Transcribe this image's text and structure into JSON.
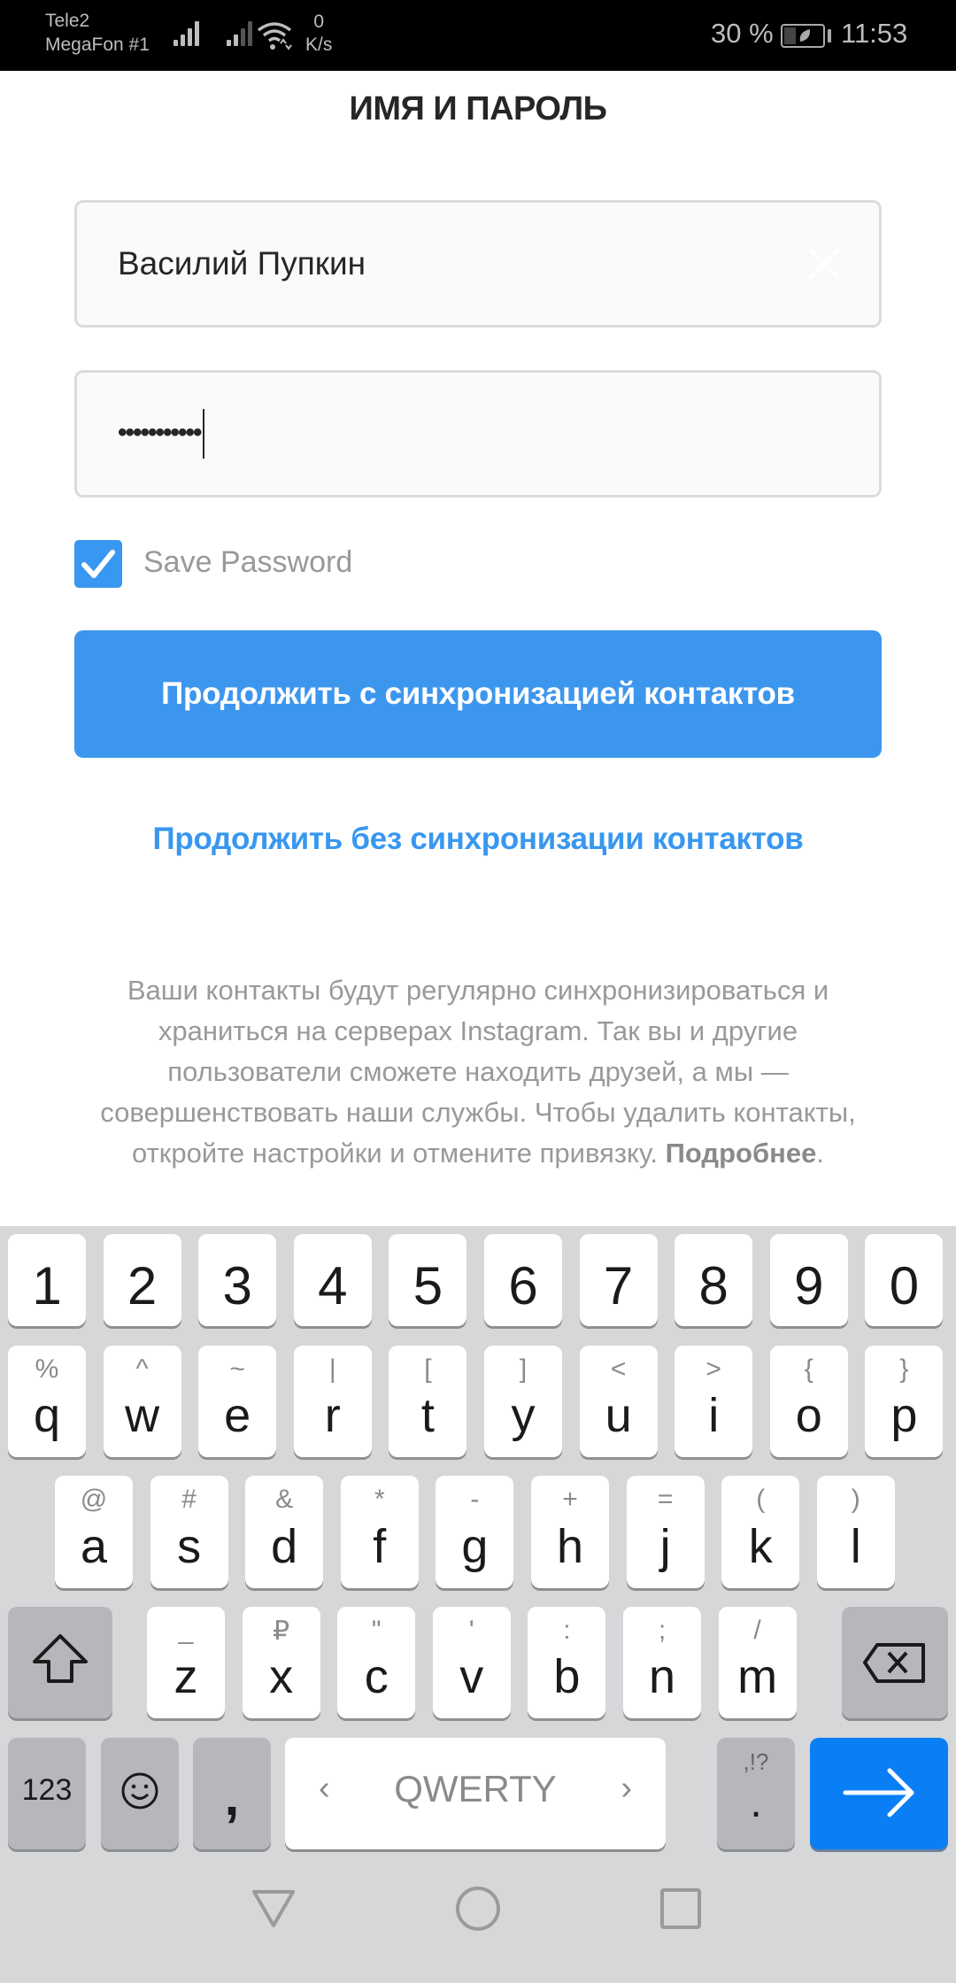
{
  "status_bar": {
    "carrier_1": "Tele2",
    "carrier_2": "MegaFon #1",
    "net_speed_value": "0",
    "net_speed_unit": "K/s",
    "battery_percent": "30 %",
    "battery_level": 0.3,
    "time": "11:53"
  },
  "page": {
    "title": "ИМЯ И ПАРОЛЬ",
    "name_field_value": "Василий Пупкин",
    "password_field_value": "•••••••••••",
    "save_password_label": "Save Password",
    "save_password_checked": true,
    "primary_button_label": "Продолжить с синхронизацией контактов",
    "secondary_link_label": "Продолжить без синхронизации контактов",
    "info_text": "Ваши контакты будут регулярно синхронизиро­ваться и храниться на серверах Instagram. Так вы и другие пользователи сможете находить друзей, а мы — совершенствовать наши службы. Чтобы удалить контакты, откройте настройки и отмените привязку. ",
    "info_link": "Подробнее",
    "info_end": "."
  },
  "colors": {
    "accent": "#3897f0",
    "enter_key": "#0a7ff5"
  },
  "keyboard": {
    "number_row": [
      "1",
      "2",
      "3",
      "4",
      "5",
      "6",
      "7",
      "8",
      "9",
      "0"
    ],
    "row1": [
      {
        "main": "q",
        "alt": "%"
      },
      {
        "main": "w",
        "alt": "^"
      },
      {
        "main": "e",
        "alt": "~"
      },
      {
        "main": "r",
        "alt": "|"
      },
      {
        "main": "t",
        "alt": "["
      },
      {
        "main": "y",
        "alt": "]"
      },
      {
        "main": "u",
        "alt": "<"
      },
      {
        "main": "i",
        "alt": ">"
      },
      {
        "main": "o",
        "alt": "{"
      },
      {
        "main": "p",
        "alt": "}"
      }
    ],
    "row2": [
      {
        "main": "a",
        "alt": "@"
      },
      {
        "main": "s",
        "alt": "#"
      },
      {
        "main": "d",
        "alt": "&"
      },
      {
        "main": "f",
        "alt": "*"
      },
      {
        "main": "g",
        "alt": "-"
      },
      {
        "main": "h",
        "alt": "+"
      },
      {
        "main": "j",
        "alt": "="
      },
      {
        "main": "k",
        "alt": "("
      },
      {
        "main": "l",
        "alt": ")"
      }
    ],
    "row3": [
      {
        "main": "z",
        "alt": "_"
      },
      {
        "main": "x",
        "alt": "₽"
      },
      {
        "main": "c",
        "alt": "\""
      },
      {
        "main": "v",
        "alt": "'"
      },
      {
        "main": "b",
        "alt": ":"
      },
      {
        "main": "n",
        "alt": ";"
      },
      {
        "main": "m",
        "alt": "/"
      }
    ],
    "symbols_key": "123",
    "comma_key": ",",
    "space_label": "QWERTY",
    "space_left": "‹",
    "space_right": "›",
    "period_key": ".",
    "period_alt": ",!?"
  }
}
